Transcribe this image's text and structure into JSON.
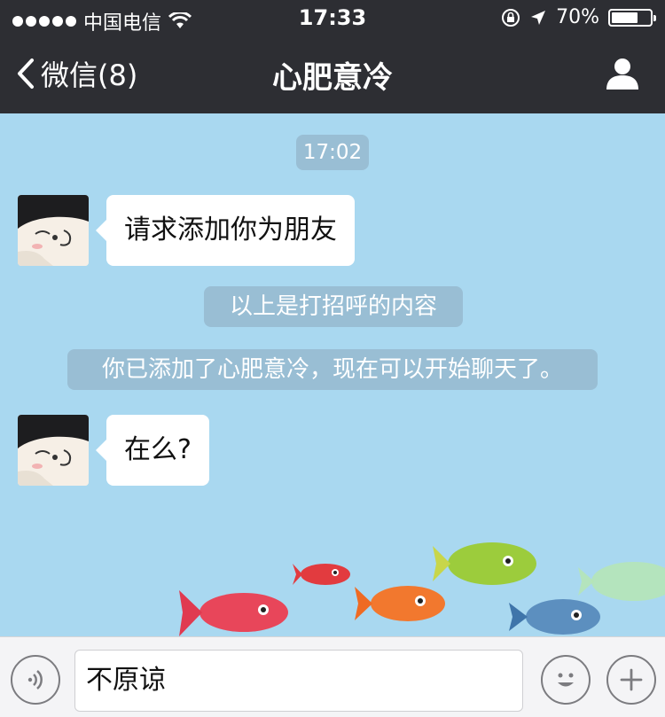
{
  "status_bar": {
    "carrier": "中国电信",
    "time": "17:33",
    "battery": "70%",
    "battery_level": 0.7
  },
  "nav": {
    "back_label": "微信(8)",
    "title": "心肥意冷",
    "profile_icon": "person-icon"
  },
  "messages": [
    {
      "type": "timestamp",
      "text": "17:02"
    },
    {
      "type": "incoming",
      "text": "请求添加你为朋友"
    },
    {
      "type": "system",
      "text": "以上是打招呼的内容"
    },
    {
      "type": "system",
      "text": "你已添加了心肥意冷，现在可以开始聊天了。"
    },
    {
      "type": "incoming",
      "text": "在么?"
    }
  ],
  "input_bar": {
    "voice_icon": "voice-icon",
    "text": "不原谅",
    "emoji_icon": "emoji-icon",
    "plus_icon": "plus-icon"
  },
  "colors": {
    "bar": "#2d2e33",
    "chat_bg": "#a9d8f0",
    "bubble": "#ffffff",
    "system_pill": "#8caabe"
  }
}
